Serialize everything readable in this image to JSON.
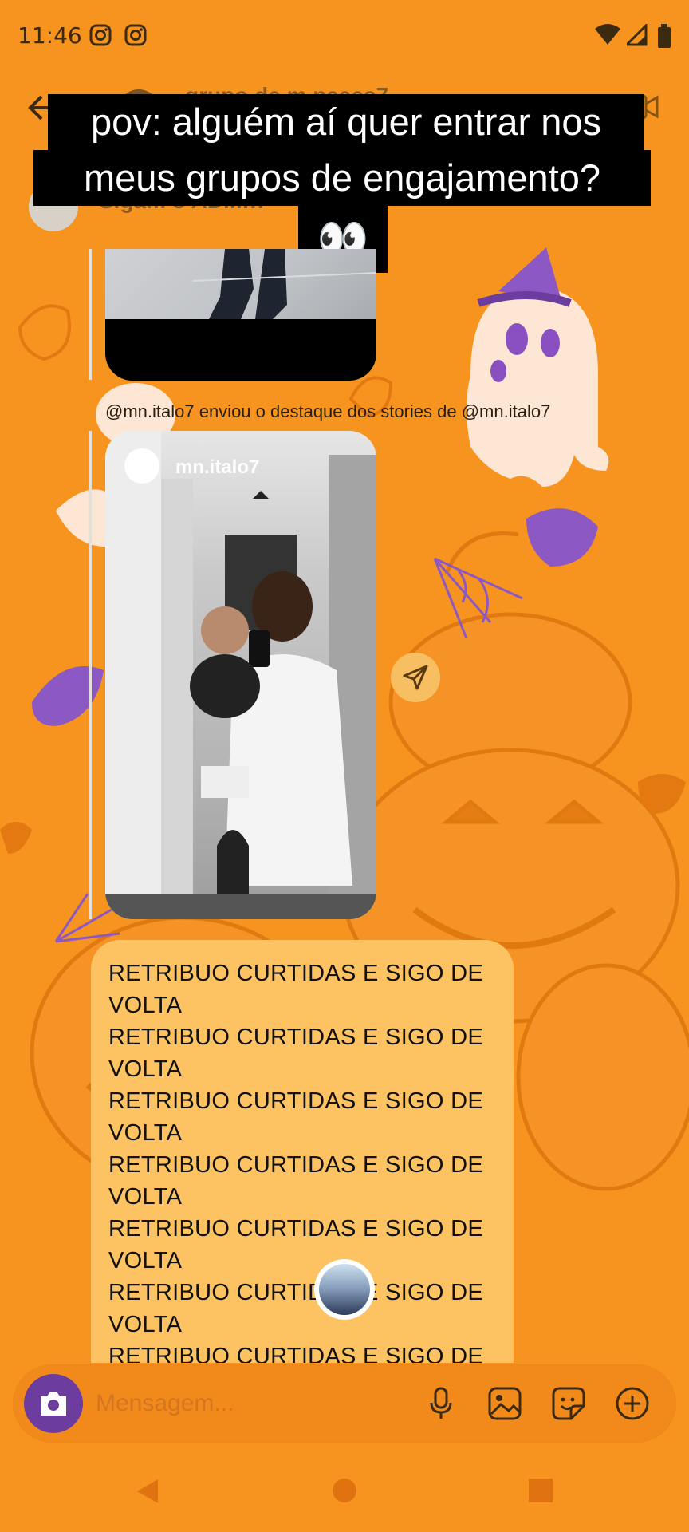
{
  "status_bar": {
    "time": "11:46"
  },
  "header": {
    "title": "grupo de m.paaes7",
    "subtitle": "Sigam o ADM!!!"
  },
  "caption": {
    "lines": [
      "pov: alguém aí quer entrar nos",
      "meus grupos de engajamento?",
      "👀"
    ]
  },
  "messages": {
    "share_text": "@mn.italo7 enviou o destaque dos stories de @mn.italo7",
    "story_author": "mn.italo7",
    "bubble_lines": [
      "RETRIBUO CURTIDAS E SIGO DE",
      "VOLTA",
      "RETRIBUO CURTIDAS E SIGO DE",
      "VOLTA",
      "RETRIBUO CURTIDAS E SIGO DE",
      "VOLTA",
      "RETRIBUO CURTIDAS E SIGO DE",
      "VOLTA",
      "RETRIBUO CURTIDAS E SIGO DE",
      "VOLTA",
      "RETRIBUO CURTIDAS E SIGO DE",
      "VOLTA",
      "RETRIBUO CURTIDAS E SIGO DE"
    ]
  },
  "composer": {
    "placeholder": "Mensagem..."
  },
  "theme": {
    "background": "#f7941f",
    "bubble": "#fdc363",
    "camera_button": "#6c3c9e",
    "pumpkin": "#f08a1c",
    "ghost": "#fde6d3",
    "leaf_purple": "#8c58c4"
  },
  "icons": {
    "status": [
      "instagram-icon",
      "instagram-icon",
      "wifi-icon",
      "signal-icon",
      "battery-icon"
    ],
    "header": [
      "back-arrow-icon",
      "phone-icon",
      "video-icon"
    ],
    "composer": [
      "camera-icon",
      "microphone-icon",
      "image-icon",
      "sticker-icon",
      "plus-circle-icon"
    ],
    "nav": [
      "back-triangle-icon",
      "home-circle-icon",
      "recents-square-icon"
    ]
  }
}
